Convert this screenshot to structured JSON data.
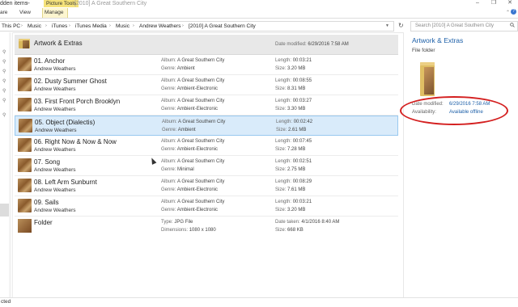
{
  "titlebar": {
    "hidden_items": "dden items",
    "overflow": "↔",
    "picture_tools": "Picture Tools",
    "window_title": "[2010] A Great Southern City"
  },
  "ribbon": {
    "tabs": [
      "are",
      "View",
      "Manage"
    ]
  },
  "address": {
    "crumbs": [
      "This PC",
      "Music",
      "iTunes",
      "iTunes Media",
      "Music",
      "Andrew Weathers",
      "[2010] A Great Southern City"
    ]
  },
  "search": {
    "placeholder": "Search [2010] A Great Southern City"
  },
  "labels": {
    "album": "Album:",
    "genre": "Genre:",
    "length": "Length:",
    "size": "Size:",
    "date_modified": "Date modified:",
    "type": "Type:",
    "dimensions": "Dimensions:",
    "date_taken": "Date taken:"
  },
  "folder_row": {
    "name": "Artwork & Extras",
    "date_modified": "6/29/2016 7:58 AM"
  },
  "tracks": [
    {
      "name": "01. Anchor",
      "artist": "Andrew Weathers",
      "album": "A Great Southern City",
      "genre": "Ambient",
      "length": "00:03:21",
      "size": "3.20 MB"
    },
    {
      "name": "02. Dusty Summer Ghost",
      "artist": "Andrew Weathers",
      "album": "A Great Southern City",
      "genre": "Ambient-Electronic",
      "length": "00:08:55",
      "size": "8.31 MB"
    },
    {
      "name": "03. First Front Porch Brooklyn",
      "artist": "Andrew Weathers",
      "album": "A Great Southern City",
      "genre": "Ambient-Electronic",
      "length": "00:03:27",
      "size": "3.30 MB"
    },
    {
      "name": "05. Object (Dialectis)",
      "artist": "Andrew Weathers",
      "album": "A Great Southern City",
      "genre": "Ambient",
      "length": "00:02:42",
      "size": "2.61 MB"
    },
    {
      "name": "06. Right Now & Now & Now",
      "artist": "Andrew Weathers",
      "album": "A Great Southern City",
      "genre": "Ambient-Electronic",
      "length": "00:07:45",
      "size": "7.28 MB"
    },
    {
      "name": "07. Song",
      "artist": "Andrew Weathers",
      "album": "A Great Southern City",
      "genre": "Minimal",
      "length": "00:02:51",
      "size": "2.75 MB"
    },
    {
      "name": "08. Left Arm Sunburnt",
      "artist": "Andrew Weathers",
      "album": "A Great Southern City",
      "genre": "Ambient-Electronic",
      "length": "00:08:29",
      "size": "7.61 MB"
    },
    {
      "name": "09. Sails",
      "artist": "Andrew Weathers",
      "album": "A Great Southern City",
      "genre": "Ambient-Electronic",
      "length": "00:03:21",
      "size": "3.20 MB"
    }
  ],
  "jpg_row": {
    "name": "Folder",
    "type": "JPG File",
    "dimensions": "1080 x 1080",
    "date_taken": "4/1/2016 8:40 AM",
    "size": "668 KB"
  },
  "details": {
    "title": "Artwork & Extras",
    "type": "File folder",
    "date_modified_label": "Date modified:",
    "date_modified": "6/29/2016 7:58 AM",
    "availability_label": "Availability:",
    "availability": "Available offline"
  },
  "status": {
    "text": "cted"
  },
  "colors": {
    "selected_row": "#d9ebfa",
    "accent": "#1c5fa8",
    "highlight_ellipse": "#d42020"
  }
}
